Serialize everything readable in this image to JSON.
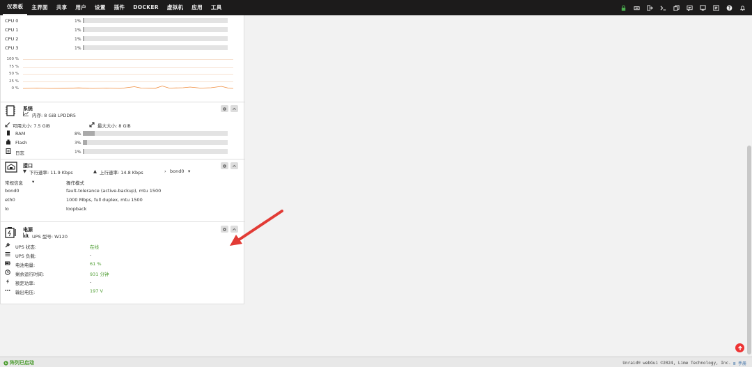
{
  "nav": [
    "仪表板",
    "主界面",
    "共享",
    "用户",
    "设置",
    "插件",
    "DOCKER",
    "虚拟机",
    "应用",
    "工具"
  ],
  "cpu": {
    "cores": [
      {
        "label": "CPU 0",
        "pct": "1%",
        "level": 0.01
      },
      {
        "label": "CPU 1",
        "pct": "1%",
        "level": 0.01
      },
      {
        "label": "CPU 2",
        "pct": "1%",
        "level": 0.01
      },
      {
        "label": "CPU 3",
        "pct": "1%",
        "level": 0.01
      }
    ],
    "graph_ticks": [
      "100 %",
      "75 %",
      "50 %",
      "25 %",
      "0 %"
    ]
  },
  "system": {
    "title": "系统",
    "subtitle": "内存: 8 GiB LPDDR5",
    "usable": "可用大小: 7.5 GiB",
    "max": "最大大小: 8 GiB",
    "rows": [
      {
        "label": "RAM",
        "pct": "8%",
        "level": 0.08
      },
      {
        "label": "Flash",
        "pct": "3%",
        "level": 0.03
      },
      {
        "label": "日志",
        "pct": "1%",
        "level": 0.01
      }
    ]
  },
  "interface": {
    "title": "接口",
    "down": "下行速率: 11.9 Kbps",
    "up": "上行速率: 14.8 Kbps",
    "iface_select": "bond0",
    "info_select": "常规信息",
    "mode_header": "操作模式",
    "rows": [
      {
        "name": "bond0",
        "mode": "fault-tolerance (active-backup), mtu 1500"
      },
      {
        "name": "eth0",
        "mode": "1000 Mbps, full duplex, mtu 1500"
      },
      {
        "name": "lo",
        "mode": "loopback"
      }
    ]
  },
  "power": {
    "title": "电源",
    "model": "UPS 型号: W120",
    "rows": [
      {
        "icon": "plug-icon",
        "label": "UPS 状态:",
        "value": "在线",
        "green": true
      },
      {
        "icon": "list-icon",
        "label": "UPS 负载:",
        "value": "-",
        "green": false
      },
      {
        "icon": "battery-icon",
        "label": "电池电量:",
        "value": "61 %",
        "green": true
      },
      {
        "icon": "clock-icon",
        "label": "剩余运行时间:",
        "value": "931 分钟",
        "green": true
      },
      {
        "icon": "bolt-icon",
        "label": "额定功率:",
        "value": "-",
        "green": false
      },
      {
        "icon": "dots-icon",
        "label": "输出电压:",
        "value": "197 V",
        "green": true
      }
    ]
  },
  "footer": {
    "status": "阵列已启动",
    "copyright": "Unraid® webGui ©2024, Lime Technology, Inc.",
    "manual": "手册"
  },
  "colors": {
    "topbar": "#1c1b1b",
    "green": "#4a9b2e",
    "arrow": "#e23b35",
    "graph": "#f08c3c"
  }
}
